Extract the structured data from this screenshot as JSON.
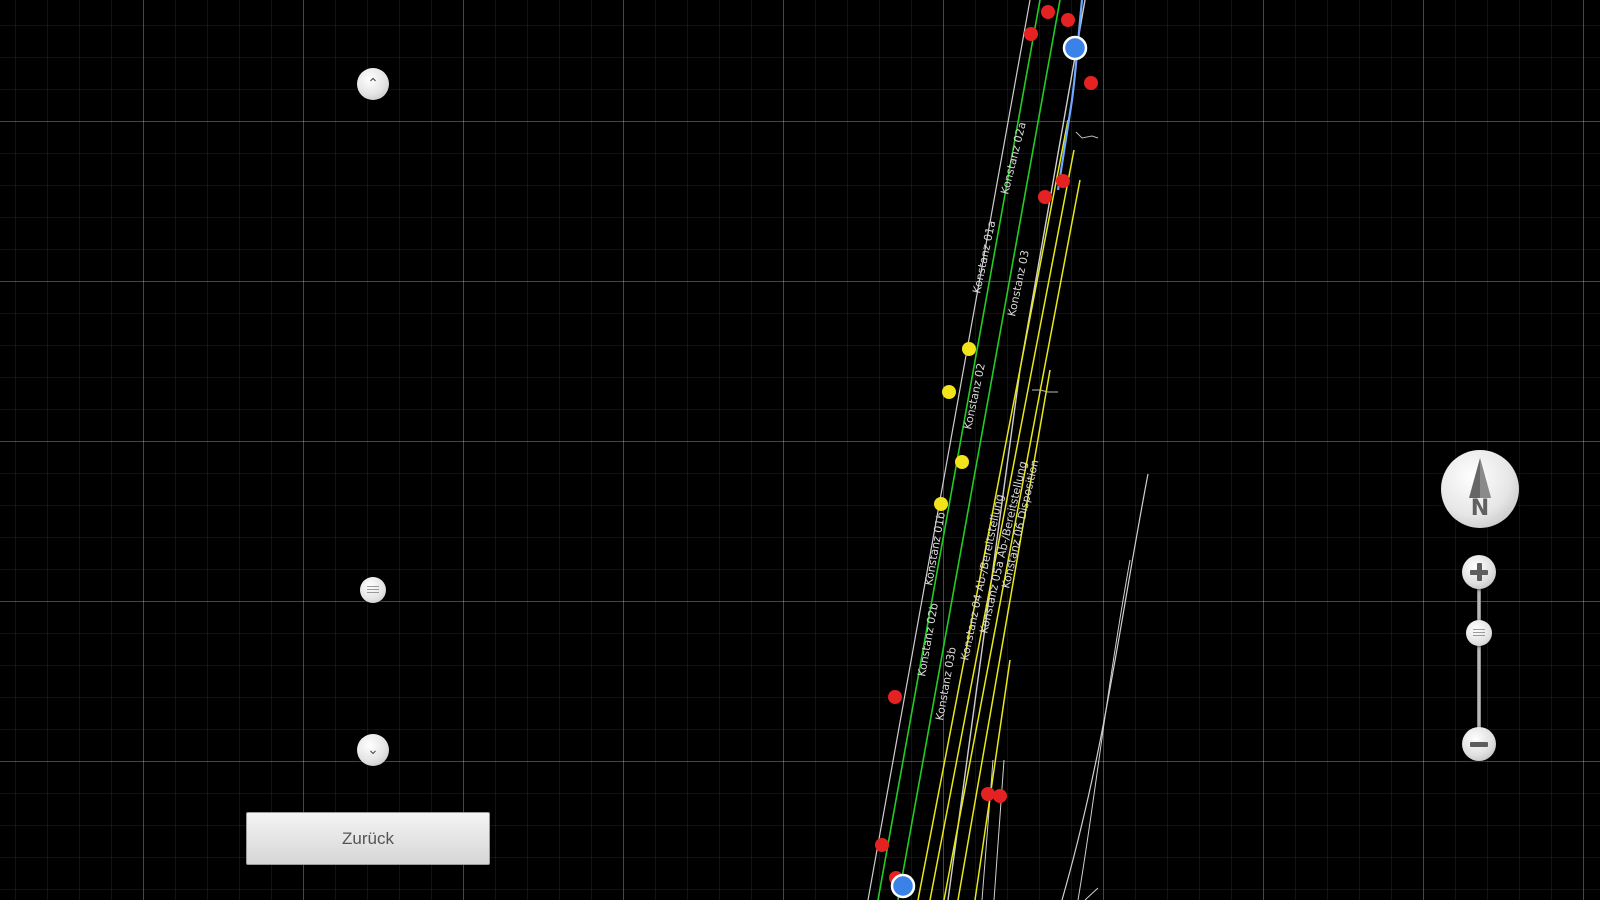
{
  "navigation": {
    "back_label": "Zurück",
    "compass_letter": "N"
  },
  "zoom": {
    "level_fraction": 0.25
  },
  "scroll": {
    "position_fraction": 0.67
  },
  "track_plan": {
    "track_labels": [
      "Konstanz 02a",
      "Konstanz 01a",
      "Konstanz 03",
      "Konstanz 02",
      "Konstanz 01b",
      "Konstanz 02b",
      "Konstanz 03b",
      "Konstanz 04 Ab-/Bereitstellung",
      "Konstanz 05a Ab-/Bereitstellung",
      "Konstanz 06 Disposition"
    ],
    "colors": {
      "background": "#000000",
      "grid": "#3a3a3a",
      "track_free": "#22cc22",
      "track_reserved": "#e8e81a",
      "track_plain": "#cfcfcf",
      "route_active": "#6fa8ff",
      "signal_stop": "#e52222",
      "signal_caution": "#f2e31b",
      "train_marker": "#3b82e8"
    }
  }
}
